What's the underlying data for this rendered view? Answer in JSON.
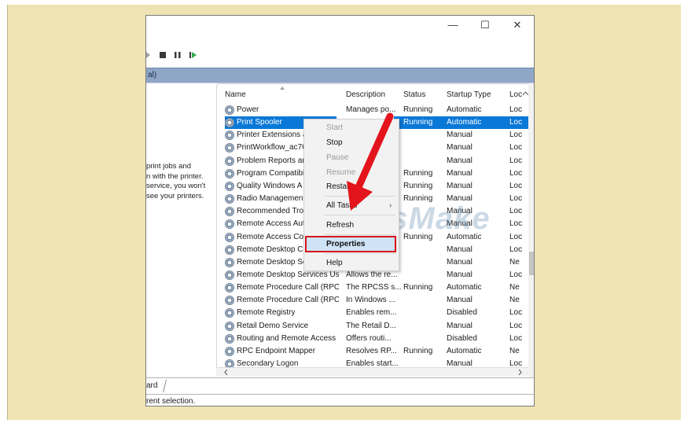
{
  "window": {
    "minimize_glyph": "—",
    "maximize_glyph": "☐",
    "close_glyph": "✕",
    "header_fragment": "al)"
  },
  "description_panel": {
    "lines": [
      "print jobs and",
      "n with the printer.",
      "service, you won't",
      "see your printers."
    ]
  },
  "columns": {
    "name": "Name",
    "description": "Description",
    "status": "Status",
    "startup_type": "Startup Type",
    "log_on": "Loc"
  },
  "services": [
    {
      "name": "Power",
      "description": "Manages po...",
      "status": "Running",
      "startup": "Automatic",
      "logon": "Loc"
    },
    {
      "name": "Print Spooler",
      "description": "",
      "status": "Running",
      "startup": "Automatic",
      "logon": "Loc"
    },
    {
      "name": "Printer Extensions a",
      "description": "",
      "status": "",
      "startup": "Manual",
      "logon": "Loc"
    },
    {
      "name": "PrintWorkflow_ac76",
      "description": "",
      "status": "",
      "startup": "Manual",
      "logon": "Loc"
    },
    {
      "name": "Problem Reports an",
      "description": "",
      "status": "",
      "startup": "Manual",
      "logon": "Loc"
    },
    {
      "name": "Program Compatibi",
      "description": "",
      "status": "Running",
      "startup": "Manual",
      "logon": "Loc"
    },
    {
      "name": "Quality Windows A",
      "description": "",
      "status": "Running",
      "startup": "Manual",
      "logon": "Loc"
    },
    {
      "name": "Radio Management",
      "description": "",
      "status": "Running",
      "startup": "Manual",
      "logon": "Loc"
    },
    {
      "name": "Recommended Trou",
      "description": "",
      "status": "",
      "startup": "Manual",
      "logon": "Loc"
    },
    {
      "name": "Remote Access Auto",
      "description": "",
      "status": "",
      "startup": "Manual",
      "logon": "Loc"
    },
    {
      "name": "Remote Access Con",
      "description": "",
      "status": "Running",
      "startup": "Automatic",
      "logon": "Loc"
    },
    {
      "name": "Remote Desktop Cc",
      "description": "",
      "status": "",
      "startup": "Manual",
      "logon": "Loc"
    },
    {
      "name": "Remote Desktop Se",
      "description": "",
      "status": "",
      "startup": "Manual",
      "logon": "Ne"
    },
    {
      "name": "Remote Desktop Services Us...",
      "description": "Allows the re...",
      "status": "",
      "startup": "Manual",
      "logon": "Loc"
    },
    {
      "name": "Remote Procedure Call (RPC)",
      "description": "The RPCSS s...",
      "status": "Running",
      "startup": "Automatic",
      "logon": "Ne"
    },
    {
      "name": "Remote Procedure Call (RPC)...",
      "description": "In Windows ...",
      "status": "",
      "startup": "Manual",
      "logon": "Ne"
    },
    {
      "name": "Remote Registry",
      "description": "Enables rem...",
      "status": "",
      "startup": "Disabled",
      "logon": "Loc"
    },
    {
      "name": "Retail Demo Service",
      "description": "The Retail D...",
      "status": "",
      "startup": "Manual",
      "logon": "Loc"
    },
    {
      "name": "Routing and Remote Access",
      "description": "Offers routi...",
      "status": "",
      "startup": "Disabled",
      "logon": "Loc"
    },
    {
      "name": "RPC Endpoint Mapper",
      "description": "Resolves RP...",
      "status": "Running",
      "startup": "Automatic",
      "logon": "Ne"
    },
    {
      "name": "Secondary Logon",
      "description": "Enables start...",
      "status": "",
      "startup": "Manual",
      "logon": "Loc"
    }
  ],
  "context_menu": {
    "start": "Start",
    "stop": "Stop",
    "pause": "Pause",
    "resume": "Resume",
    "restart": "Restart",
    "all_tasks": "All Tasks",
    "submenu_arrow": "›",
    "refresh": "Refresh",
    "properties": "Properties",
    "help": "Help"
  },
  "tab": {
    "label": "ard"
  },
  "status": {
    "text": "rent selection."
  },
  "watermark": "TipsMake",
  "colors": {
    "background": "#efe3b4",
    "selection": "#0a78d7",
    "highlight_box": "#d5151b",
    "arrow": "#e3141c"
  },
  "icons": [
    "service-gear-icon",
    "stop-icon",
    "pause-icon",
    "play-icon",
    "sort-up-icon",
    "scroll-up-icon",
    "scroll-down-icon",
    "scroll-left-icon",
    "scroll-right-icon",
    "red-arrow-pointer"
  ]
}
